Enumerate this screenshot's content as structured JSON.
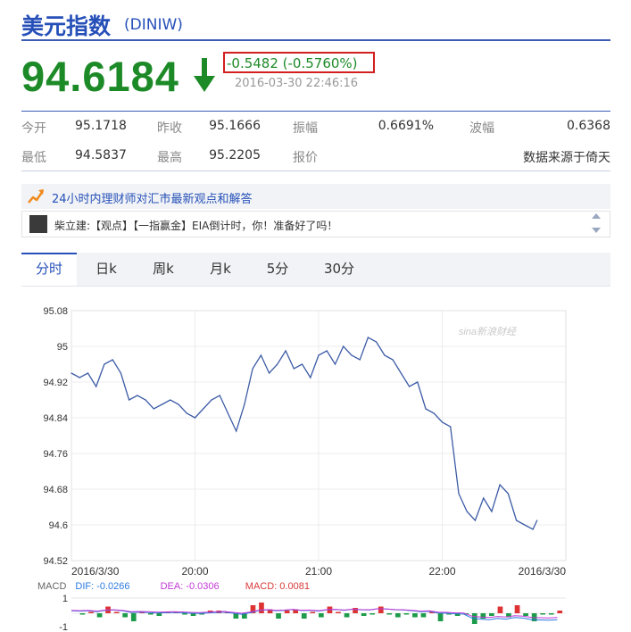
{
  "header": {
    "title": "美元指数",
    "code": "(DINIW)"
  },
  "quote": {
    "price": "94.6184",
    "change": "-0.5482 (-0.5760%)",
    "timestamp": "2016-03-30 22:46:16",
    "direction": "down",
    "colors": {
      "price": "#1d8a28",
      "highlight_box": "#d21f1f"
    }
  },
  "stats": {
    "row1": [
      {
        "label": "今开",
        "value": "95.1718"
      },
      {
        "label": "昨收",
        "value": "95.1666"
      },
      {
        "label": "振幅",
        "value": "0.6691%"
      },
      {
        "label": "波幅",
        "value": "0.6368"
      }
    ],
    "row2": [
      {
        "label": "最低",
        "value": "94.5837"
      },
      {
        "label": "最高",
        "value": "95.2205"
      },
      {
        "label": "报价",
        "value": ""
      },
      {
        "label": "",
        "value": "数据来源于倚天"
      }
    ]
  },
  "news": {
    "headline": "24小时内理财师对汇市最新观点和解答",
    "post": "柴立建:【观点】【一指赢金】EIA倒计时，你！准备好了吗！"
  },
  "tabs": [
    "分时",
    "日k",
    "周k",
    "月k",
    "5分",
    "30分"
  ],
  "active_tab": "分时",
  "chart_data": {
    "type": "line",
    "watermark": "sina新浪财经",
    "ylim": [
      94.52,
      95.08
    ],
    "yticks": [
      "95.08",
      "95",
      "94.92",
      "94.84",
      "94.76",
      "94.68",
      "94.6",
      "94.52"
    ],
    "x_labels": [
      "2016/3/30",
      "20:00",
      "21:00",
      "22:00",
      "2016/3/30"
    ],
    "x_label_times": [
      "19:00",
      "20:00",
      "21:00",
      "22:00",
      "23:00"
    ],
    "x_range": [
      "19:00",
      "23:00"
    ],
    "series": [
      {
        "x": [
          "19:00",
          "19:04",
          "19:08",
          "19:12",
          "19:16",
          "19:20",
          "19:24",
          "19:28",
          "19:32",
          "19:36",
          "19:40",
          "19:44",
          "19:48",
          "19:52",
          "19:56",
          "20:00",
          "20:04",
          "20:08",
          "20:12",
          "20:16",
          "20:20",
          "20:24",
          "20:28",
          "20:32",
          "20:36",
          "20:40",
          "20:44",
          "20:48",
          "20:52",
          "20:56",
          "21:00",
          "21:04",
          "21:08",
          "21:12",
          "21:16",
          "21:20",
          "21:24",
          "21:28",
          "21:32",
          "21:36",
          "21:40",
          "21:44",
          "21:48",
          "21:52",
          "21:56",
          "22:00",
          "22:04",
          "22:08",
          "22:12",
          "22:16",
          "22:20",
          "22:24",
          "22:28",
          "22:32",
          "22:36",
          "22:40",
          "22:44",
          "22:46"
        ],
        "values": [
          94.94,
          94.93,
          94.94,
          94.91,
          94.96,
          94.97,
          94.94,
          94.88,
          94.89,
          94.88,
          94.86,
          94.87,
          94.88,
          94.87,
          94.85,
          94.84,
          94.86,
          94.88,
          94.89,
          94.85,
          94.81,
          94.87,
          94.95,
          94.98,
          94.94,
          94.96,
          94.99,
          94.95,
          94.96,
          94.93,
          94.98,
          94.99,
          94.96,
          95.0,
          94.98,
          94.97,
          95.02,
          95.01,
          94.98,
          94.97,
          94.94,
          94.91,
          94.92,
          94.86,
          94.85,
          94.83,
          94.82,
          94.67,
          94.63,
          94.61,
          94.66,
          94.63,
          94.69,
          94.67,
          94.61,
          94.6,
          94.59,
          94.61
        ],
        "color": "#3d5ca6"
      }
    ],
    "macd": {
      "dif": "-0.0266",
      "dea": "-0.0306",
      "macd": "0.0081",
      "yticks": [
        "1",
        "-1"
      ],
      "labels": {
        "name": "MACD",
        "dif": "DIF:",
        "dea": "DEA:",
        "macd": "MACD:"
      },
      "colors": {
        "dif": "#2c7ae0",
        "dea": "#c23ad6",
        "macd": "#d83a3a",
        "positive": "#d33",
        "negative": "#1c9b4a"
      }
    }
  }
}
